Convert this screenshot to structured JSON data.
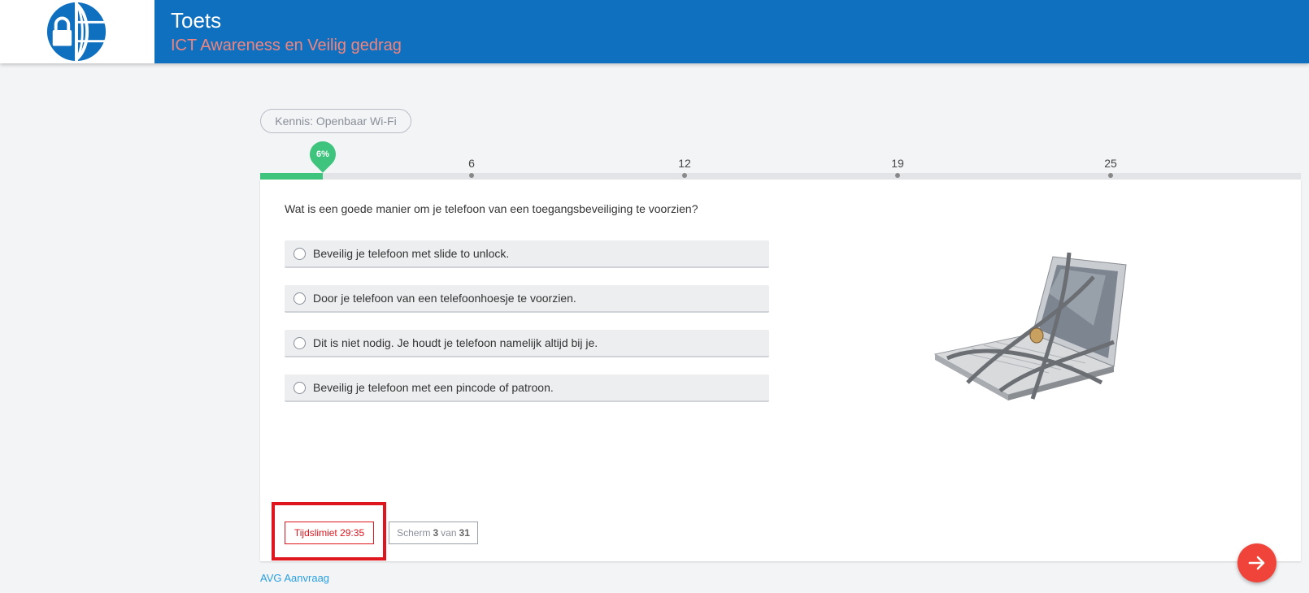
{
  "header": {
    "title": "Toets",
    "subtitle": "ICT Awareness en Veilig gedrag",
    "logo_icon": "lock-globe-icon"
  },
  "category": "Kennis: Openbaar Wi-Fi",
  "progress": {
    "percent_label": "6%",
    "percent": 6,
    "milestones": [
      "6",
      "12",
      "19",
      "25"
    ]
  },
  "question": {
    "text": "Wat is een goede manier om je telefoon van een toegangsbeveiliging te voorzien?",
    "options": [
      "Beveilig je telefoon met slide to unlock.",
      "Door je telefoon van een telefoonhoesje te voorzien.",
      "Dit is niet nodig. Je houdt je telefoon namelijk altijd bij je.",
      "Beveilig je telefoon met een pincode of patroon."
    ],
    "image_icon": "chained-laptop-icon"
  },
  "footer": {
    "timer_label": "Tijdslimiet 29:35",
    "screen_prefix": "Scherm",
    "screen_current": "3",
    "screen_mid": "van",
    "screen_total": "31",
    "avg_link": "AVG Aanvraag"
  },
  "colors": {
    "header_bg": "#1070c0",
    "subtitle": "#f2847c",
    "progress": "#3ec47c",
    "timer": "#e0161e",
    "next_button": "#f0443a",
    "link": "#2aa0e0"
  }
}
